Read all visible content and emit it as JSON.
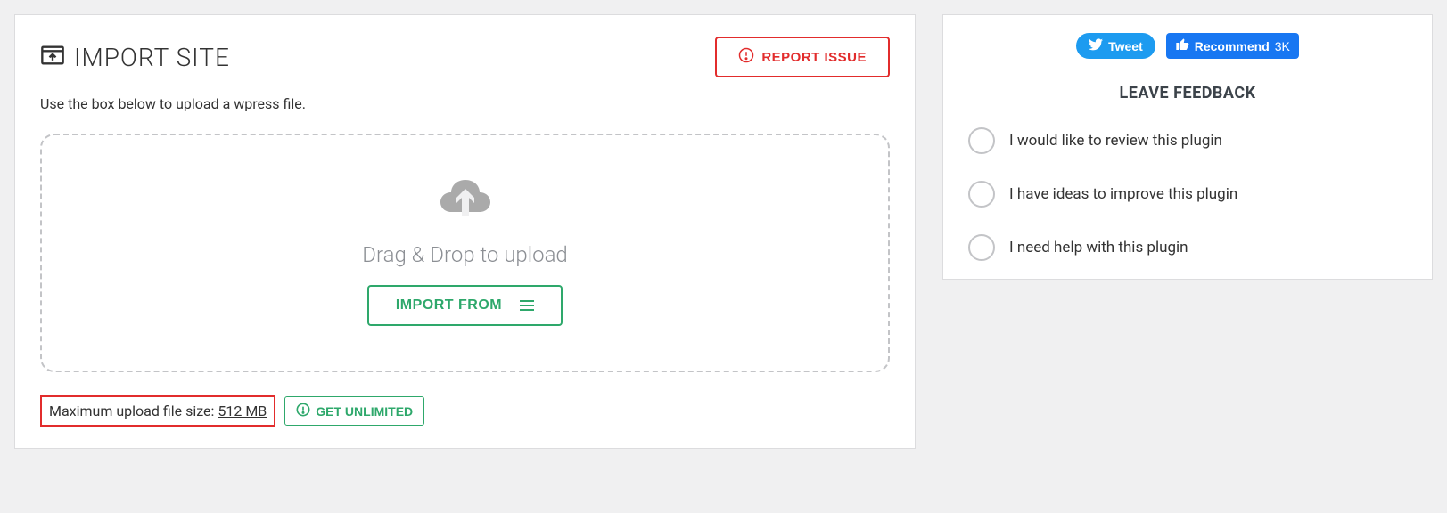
{
  "header": {
    "title": "IMPORT SITE",
    "report_label": "REPORT ISSUE"
  },
  "subtitle": "Use the box below to upload a wpress file.",
  "dropzone": {
    "text": "Drag & Drop to upload",
    "import_label": "IMPORT FROM"
  },
  "footer": {
    "max_label": "Maximum upload file size: ",
    "max_value": "512 MB",
    "unlimited_label": "GET UNLIMITED"
  },
  "sidebar": {
    "tweet": "Tweet",
    "fb_label": "Recommend",
    "fb_count": "3K",
    "feedback_title": "LEAVE FEEDBACK",
    "options": [
      "I would like to review this plugin",
      "I have ideas to improve this plugin",
      "I need help with this plugin"
    ]
  }
}
